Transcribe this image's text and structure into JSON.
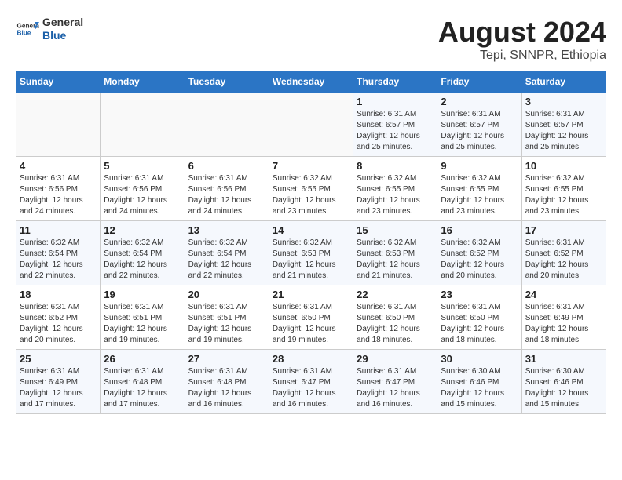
{
  "header": {
    "logo_general": "General",
    "logo_blue": "Blue",
    "main_title": "August 2024",
    "subtitle": "Tepi, SNNPR, Ethiopia"
  },
  "days_of_week": [
    "Sunday",
    "Monday",
    "Tuesday",
    "Wednesday",
    "Thursday",
    "Friday",
    "Saturday"
  ],
  "weeks": [
    [
      {
        "day": "",
        "info": ""
      },
      {
        "day": "",
        "info": ""
      },
      {
        "day": "",
        "info": ""
      },
      {
        "day": "",
        "info": ""
      },
      {
        "day": "1",
        "info": "Sunrise: 6:31 AM\nSunset: 6:57 PM\nDaylight: 12 hours\nand 25 minutes."
      },
      {
        "day": "2",
        "info": "Sunrise: 6:31 AM\nSunset: 6:57 PM\nDaylight: 12 hours\nand 25 minutes."
      },
      {
        "day": "3",
        "info": "Sunrise: 6:31 AM\nSunset: 6:57 PM\nDaylight: 12 hours\nand 25 minutes."
      }
    ],
    [
      {
        "day": "4",
        "info": "Sunrise: 6:31 AM\nSunset: 6:56 PM\nDaylight: 12 hours\nand 24 minutes."
      },
      {
        "day": "5",
        "info": "Sunrise: 6:31 AM\nSunset: 6:56 PM\nDaylight: 12 hours\nand 24 minutes."
      },
      {
        "day": "6",
        "info": "Sunrise: 6:31 AM\nSunset: 6:56 PM\nDaylight: 12 hours\nand 24 minutes."
      },
      {
        "day": "7",
        "info": "Sunrise: 6:32 AM\nSunset: 6:55 PM\nDaylight: 12 hours\nand 23 minutes."
      },
      {
        "day": "8",
        "info": "Sunrise: 6:32 AM\nSunset: 6:55 PM\nDaylight: 12 hours\nand 23 minutes."
      },
      {
        "day": "9",
        "info": "Sunrise: 6:32 AM\nSunset: 6:55 PM\nDaylight: 12 hours\nand 23 minutes."
      },
      {
        "day": "10",
        "info": "Sunrise: 6:32 AM\nSunset: 6:55 PM\nDaylight: 12 hours\nand 23 minutes."
      }
    ],
    [
      {
        "day": "11",
        "info": "Sunrise: 6:32 AM\nSunset: 6:54 PM\nDaylight: 12 hours\nand 22 minutes."
      },
      {
        "day": "12",
        "info": "Sunrise: 6:32 AM\nSunset: 6:54 PM\nDaylight: 12 hours\nand 22 minutes."
      },
      {
        "day": "13",
        "info": "Sunrise: 6:32 AM\nSunset: 6:54 PM\nDaylight: 12 hours\nand 22 minutes."
      },
      {
        "day": "14",
        "info": "Sunrise: 6:32 AM\nSunset: 6:53 PM\nDaylight: 12 hours\nand 21 minutes."
      },
      {
        "day": "15",
        "info": "Sunrise: 6:32 AM\nSunset: 6:53 PM\nDaylight: 12 hours\nand 21 minutes."
      },
      {
        "day": "16",
        "info": "Sunrise: 6:32 AM\nSunset: 6:52 PM\nDaylight: 12 hours\nand 20 minutes."
      },
      {
        "day": "17",
        "info": "Sunrise: 6:31 AM\nSunset: 6:52 PM\nDaylight: 12 hours\nand 20 minutes."
      }
    ],
    [
      {
        "day": "18",
        "info": "Sunrise: 6:31 AM\nSunset: 6:52 PM\nDaylight: 12 hours\nand 20 minutes."
      },
      {
        "day": "19",
        "info": "Sunrise: 6:31 AM\nSunset: 6:51 PM\nDaylight: 12 hours\nand 19 minutes."
      },
      {
        "day": "20",
        "info": "Sunrise: 6:31 AM\nSunset: 6:51 PM\nDaylight: 12 hours\nand 19 minutes."
      },
      {
        "day": "21",
        "info": "Sunrise: 6:31 AM\nSunset: 6:50 PM\nDaylight: 12 hours\nand 19 minutes."
      },
      {
        "day": "22",
        "info": "Sunrise: 6:31 AM\nSunset: 6:50 PM\nDaylight: 12 hours\nand 18 minutes."
      },
      {
        "day": "23",
        "info": "Sunrise: 6:31 AM\nSunset: 6:50 PM\nDaylight: 12 hours\nand 18 minutes."
      },
      {
        "day": "24",
        "info": "Sunrise: 6:31 AM\nSunset: 6:49 PM\nDaylight: 12 hours\nand 18 minutes."
      }
    ],
    [
      {
        "day": "25",
        "info": "Sunrise: 6:31 AM\nSunset: 6:49 PM\nDaylight: 12 hours\nand 17 minutes."
      },
      {
        "day": "26",
        "info": "Sunrise: 6:31 AM\nSunset: 6:48 PM\nDaylight: 12 hours\nand 17 minutes."
      },
      {
        "day": "27",
        "info": "Sunrise: 6:31 AM\nSunset: 6:48 PM\nDaylight: 12 hours\nand 16 minutes."
      },
      {
        "day": "28",
        "info": "Sunrise: 6:31 AM\nSunset: 6:47 PM\nDaylight: 12 hours\nand 16 minutes."
      },
      {
        "day": "29",
        "info": "Sunrise: 6:31 AM\nSunset: 6:47 PM\nDaylight: 12 hours\nand 16 minutes."
      },
      {
        "day": "30",
        "info": "Sunrise: 6:30 AM\nSunset: 6:46 PM\nDaylight: 12 hours\nand 15 minutes."
      },
      {
        "day": "31",
        "info": "Sunrise: 6:30 AM\nSunset: 6:46 PM\nDaylight: 12 hours\nand 15 minutes."
      }
    ]
  ]
}
